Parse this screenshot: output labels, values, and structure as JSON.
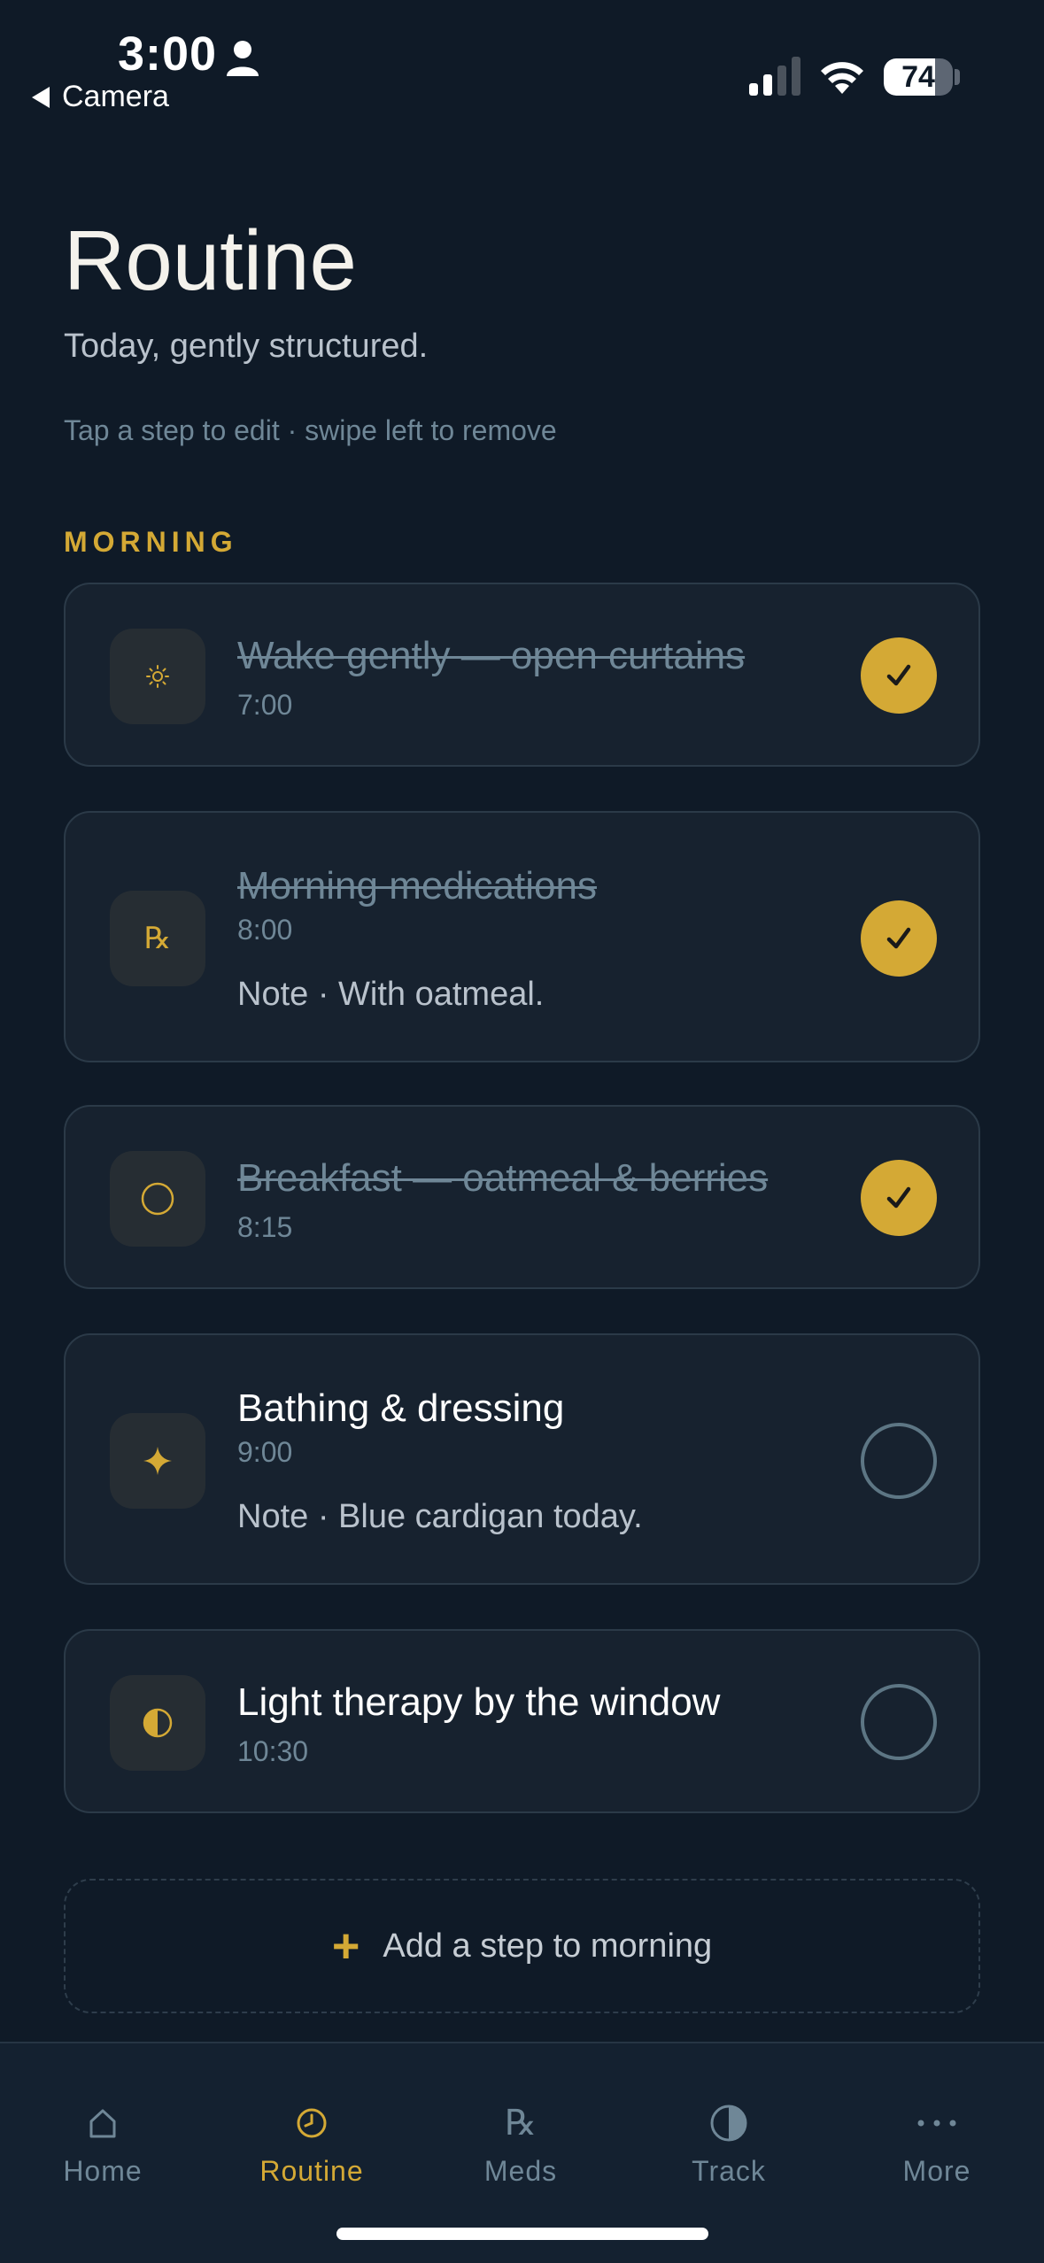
{
  "status_bar": {
    "time": "3:00",
    "back_label": "Camera",
    "battery": "74"
  },
  "header": {
    "title": "Routine",
    "subtitle": "Today, gently structured.",
    "hint": "Tap a step to edit · swipe left to remove"
  },
  "section": {
    "label": "MORNING"
  },
  "steps": [
    {
      "title": "Wake gently — open curtains",
      "time": "7:00",
      "note": "",
      "done": true,
      "icon": "sun-icon"
    },
    {
      "title": "Morning medications",
      "time": "8:00",
      "note": "Note · With oatmeal.",
      "done": true,
      "icon": "rx-icon"
    },
    {
      "title": "Breakfast — oatmeal & berries",
      "time": "8:15",
      "note": "",
      "done": true,
      "icon": "circle-icon"
    },
    {
      "title": "Bathing & dressing",
      "time": "9:00",
      "note": "Note · Blue cardigan today.",
      "done": false,
      "icon": "sparkle-icon"
    },
    {
      "title": "Light therapy by the window",
      "time": "10:30",
      "note": "",
      "done": false,
      "icon": "half-circle-icon"
    }
  ],
  "add_step": {
    "label": "Add a step to morning"
  },
  "tabs": [
    {
      "label": "Home",
      "icon": "house-icon",
      "active": false
    },
    {
      "label": "Routine",
      "icon": "clock-icon",
      "active": true
    },
    {
      "label": "Meds",
      "icon": "rx-icon",
      "active": false
    },
    {
      "label": "Track",
      "icon": "half-circle-icon",
      "active": false
    },
    {
      "label": "More",
      "icon": "more-dots-icon",
      "active": false
    }
  ],
  "colors": {
    "accent": "#d4a935",
    "background": "#0f1a27",
    "card": "#17222f",
    "muted": "#6f8797"
  }
}
